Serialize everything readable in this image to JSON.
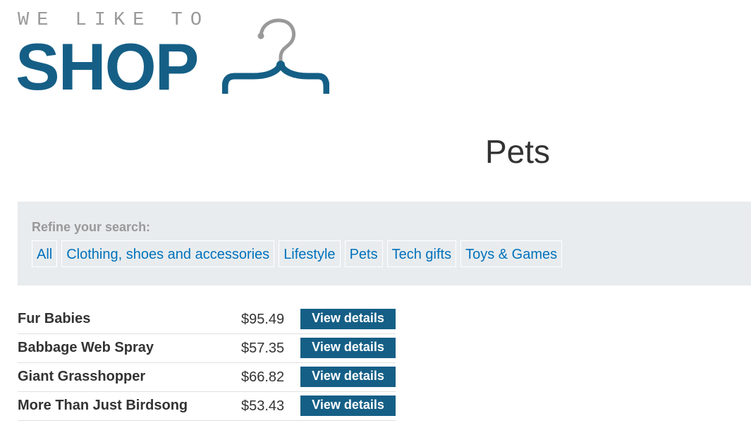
{
  "logo": {
    "line1": "WE LIKE TO",
    "line2": "SHOP",
    "icon": "hanger-icon",
    "brand_color": "#155f86"
  },
  "page_title": "Pets",
  "filters": {
    "heading": "Refine your search:",
    "categories": [
      "All",
      "Clothing, shoes and accessories",
      "Lifestyle",
      "Pets",
      "Tech gifts",
      "Toys & Games"
    ],
    "link_color": "#0071bc"
  },
  "products": [
    {
      "name": "Fur Babies",
      "price": "$95.49",
      "button": "View details"
    },
    {
      "name": "Babbage Web Spray",
      "price": "$57.35",
      "button": "View details"
    },
    {
      "name": "Giant Grasshopper",
      "price": "$66.82",
      "button": "View details"
    },
    {
      "name": "More Than Just Birdsong",
      "price": "$53.43",
      "button": "View details"
    }
  ]
}
